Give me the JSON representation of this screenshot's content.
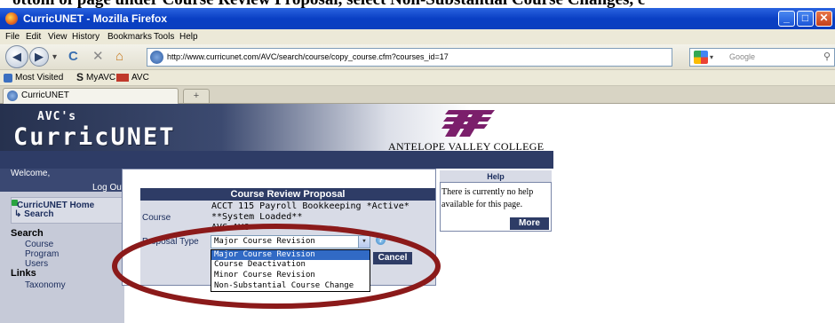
{
  "instruction": "ottom of page under Course Review Proposal, select Non-Substantial Course Changes, c",
  "window": {
    "title": "CurricUNET - Mozilla Firefox",
    "minimize": "_",
    "maximize": "□",
    "close": "✕"
  },
  "menu": [
    "File",
    "Edit",
    "View",
    "History",
    "Bookmarks",
    "Tools",
    "Help"
  ],
  "nav": {
    "url": "http://www.curricunet.com/AVC/search/course/copy_course.cfm?courses_id=17",
    "search_placeholder": "Google"
  },
  "bookmarks": [
    "Most Visited",
    "MyAVC",
    "AVC"
  ],
  "tab": {
    "label": "CurricUNET",
    "new": "+"
  },
  "header": {
    "logo_small": "AVC's",
    "logo_big": "CurricUNET",
    "college": "ANTELOPE VALLEY COLLEGE"
  },
  "sidebar": {
    "welcome": "Welcome,",
    "logout": "Log Out",
    "home_line1": "CurricUNET Home",
    "home_line2": "Search",
    "search_heading": "Search",
    "search_items": [
      "Course",
      "Program",
      "Users"
    ],
    "links_heading": "Links",
    "links_items": [
      "Taxonomy"
    ]
  },
  "form": {
    "title": "Course Review Proposal",
    "course_label": "Course",
    "course_value_line1": "ACCT 115 Payroll Bookkeeping *Active*",
    "course_value_line2": "**System Loaded**",
    "course_value_line3": "AVC AVC",
    "proposal_label": "Proposal Type",
    "proposal_selected": "Major Course Revision",
    "options": [
      "Major Course Revision",
      "Course Deactivation",
      "Minor Course Revision",
      "Non-Substantial Course Change"
    ],
    "cancel": "Cancel",
    "help_glyph": "?"
  },
  "help": {
    "title": "Help",
    "text": "There is currently no help available for this page.",
    "more": "More"
  },
  "colors": {
    "annotation": "#8b1a1a",
    "header_navy": "#2e3c66",
    "selection": "#316ac5"
  }
}
